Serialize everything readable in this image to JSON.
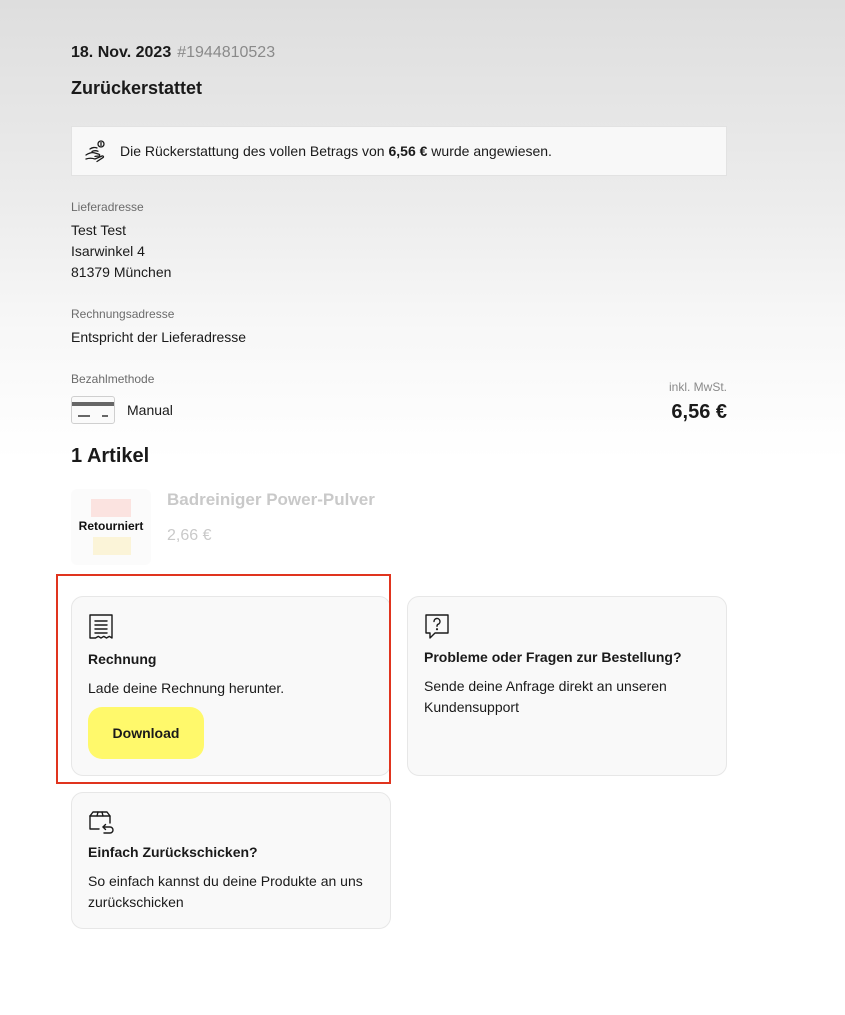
{
  "order": {
    "date": "18. Nov. 2023",
    "number": "#1944810523",
    "status": "Zurückerstattet"
  },
  "notice": {
    "icon": "refund-hand-icon",
    "text_before": "Die Rückerstattung des vollen Betrags von ",
    "amount": "6,56 €",
    "text_after": " wurde angewiesen."
  },
  "shipping": {
    "label": "Lieferadresse",
    "lines": [
      "Test Test",
      "Isarwinkel 4",
      "81379 München"
    ]
  },
  "billing": {
    "label": "Rechnungsadresse",
    "value": "Entspricht der Lieferadresse"
  },
  "payment": {
    "label": "Bezahlmethode",
    "method": "Manual",
    "icon": "credit-card-icon"
  },
  "totals": {
    "tax_label": "inkl. MwSt.",
    "total": "6,56 €"
  },
  "items": {
    "title": "1 Artikel",
    "list": [
      {
        "badge": "Retourniert",
        "name": "Badreiniger Power-Pulver",
        "price": "2,66 €"
      }
    ]
  },
  "cards": {
    "invoice": {
      "icon": "receipt-icon",
      "title": "Rechnung",
      "text": "Lade deine Rechnung herunter.",
      "button": "Download"
    },
    "support": {
      "icon": "question-bubble-icon",
      "title": "Probleme oder Fragen zur Bestellung?",
      "text": "Sende deine Anfrage direkt an unseren Kundensupport"
    },
    "return": {
      "icon": "box-return-icon",
      "title": "Einfach Zurückschicken?",
      "text": "So einfach kannst du deine Produkte an uns zurückschicken"
    }
  },
  "colors": {
    "accent_button": "#fff96b",
    "highlight_border": "#e0341e",
    "muted_text": "#8a8a8a"
  }
}
